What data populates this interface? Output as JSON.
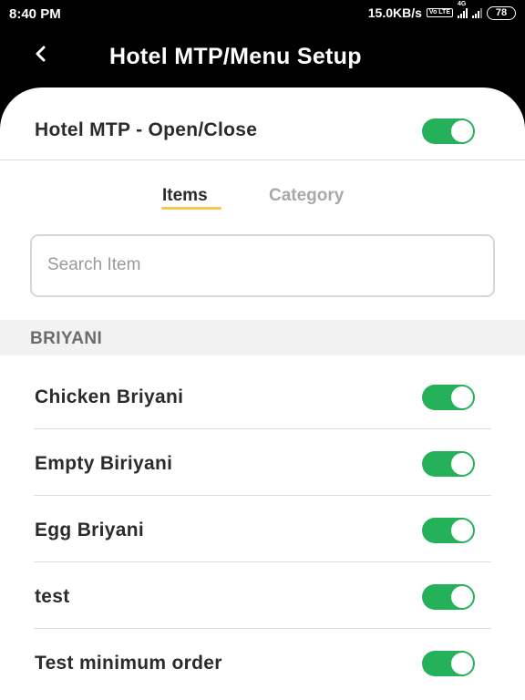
{
  "status_bar": {
    "time": "8:40 PM",
    "speed": "15.0KB/s",
    "volte_badge": "Vo LTE",
    "network_type": "4G",
    "battery": "78"
  },
  "header": {
    "back_icon": "chevron-left-icon",
    "title": "Hotel MTP/Menu Setup"
  },
  "master_toggle": {
    "label": "Hotel MTP - Open/Close",
    "on": true
  },
  "tabs": [
    {
      "label": "Items",
      "active": true
    },
    {
      "label": "Category",
      "active": false
    }
  ],
  "search": {
    "placeholder": "Search Item",
    "value": ""
  },
  "section": {
    "title": "BRIYANI",
    "items": [
      {
        "label": "Chicken Briyani",
        "on": true
      },
      {
        "label": "Empty Biriyani",
        "on": true
      },
      {
        "label": "Egg Briyani",
        "on": true
      },
      {
        "label": "test",
        "on": true
      },
      {
        "label": "Test minimum order",
        "on": true
      }
    ]
  },
  "colors": {
    "toggle_on": "#25b15a",
    "tab_underline": "#f2c94c",
    "header_bg": "#000000"
  }
}
